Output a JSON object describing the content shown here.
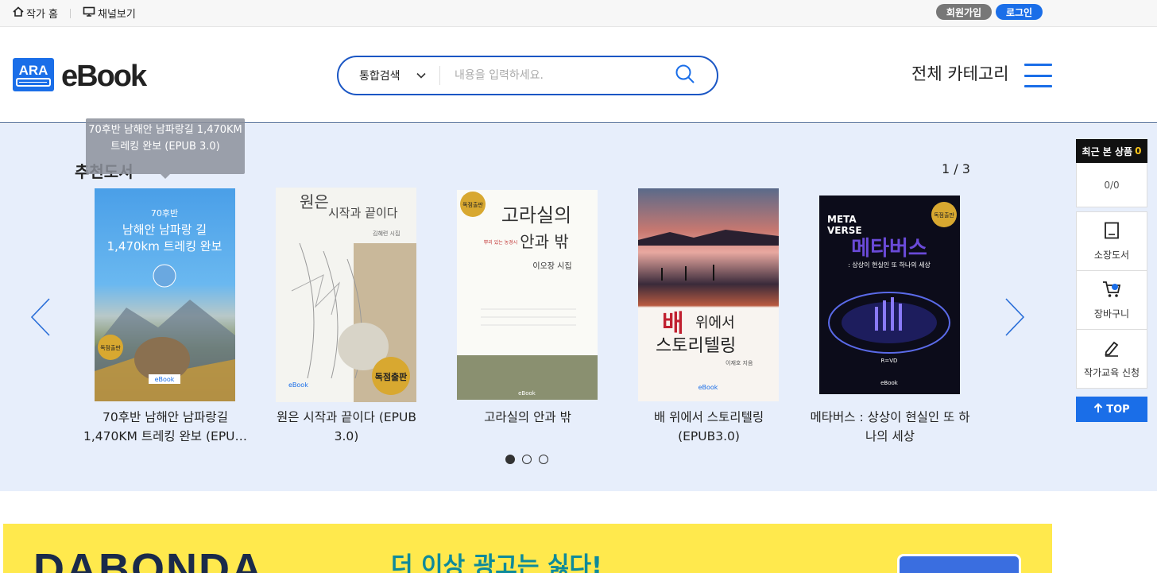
{
  "topbar": {
    "author_home": "작가 홈",
    "channel_view": "채널보기",
    "signup": "회원가입",
    "login": "로그인"
  },
  "header": {
    "logo_text": "eBook",
    "search": {
      "select_value": "통합검색",
      "placeholder": "내용을 입력하세요."
    },
    "all_category": "전체 카테고리"
  },
  "recommend": {
    "title": "추천도서",
    "page_indicator": "1 / 3",
    "tooltip": "70후반 남해안 남파랑길 1,470KM 트레킹 완보 (EPUB 3.0)",
    "books": [
      {
        "caption_line1": "70후반 남해안 남파랑길",
        "caption_line2": "1,470KM 트레킹 완보 (EPU…",
        "cover_text": "70후반 남해안 남파랑 길 1,470km 트레킹 완보",
        "cover_badge": "독점출판"
      },
      {
        "caption_line1": "원은 시작과 끝이다 (EPUB",
        "caption_line2": "3.0)",
        "cover_text": "원은 시작과 끝이다",
        "cover_badge": "독점출판"
      },
      {
        "caption_line1": "고라실의 안과 밖",
        "caption_line2": "",
        "cover_text": "고라실의 안과 밖",
        "cover_badge": "독점출판"
      },
      {
        "caption_line1": "배 위에서 스토리텔링",
        "caption_line2": "(EPUB3.0)",
        "cover_text": "배 위에서 스토리텔링",
        "cover_badge": ""
      },
      {
        "caption_line1": "메타버스 : 상상이 현실인 또 하",
        "caption_line2": "나의 세상",
        "cover_text": "메타버스",
        "cover_badge": "독점출판"
      }
    ]
  },
  "sidebar": {
    "recent_label": "최근 본 상품",
    "recent_count": "0",
    "paging": "0/0",
    "owned": "소장도서",
    "cart": "장바구니",
    "author_edu": "작가교육 신청",
    "top": "TOP"
  },
  "banner": {
    "logo": "DABONDA",
    "headline": "더 이상 광고는 싫다!"
  },
  "colors": {
    "accent": "#1a6ee8",
    "recommend_bg": "#e7eefb",
    "banner_bg": "#ffe94d"
  }
}
